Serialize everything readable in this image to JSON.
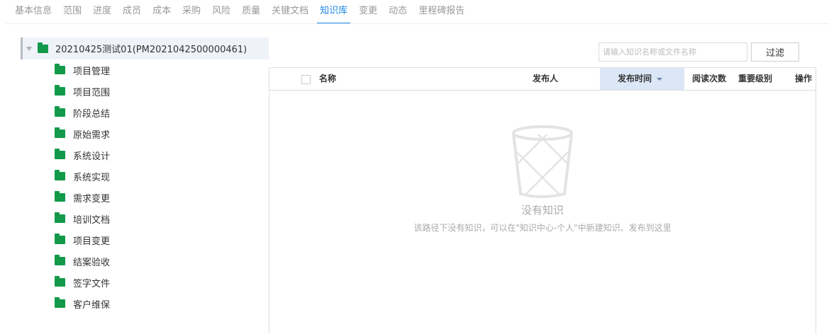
{
  "tabs": [
    {
      "label": "基本信息",
      "active": false
    },
    {
      "label": "范围",
      "active": false
    },
    {
      "label": "进度",
      "active": false
    },
    {
      "label": "成员",
      "active": false
    },
    {
      "label": "成本",
      "active": false
    },
    {
      "label": "采购",
      "active": false
    },
    {
      "label": "风险",
      "active": false
    },
    {
      "label": "质量",
      "active": false
    },
    {
      "label": "关键文档",
      "active": false
    },
    {
      "label": "知识库",
      "active": true
    },
    {
      "label": "变更",
      "active": false
    },
    {
      "label": "动态",
      "active": false
    },
    {
      "label": "里程碑报告",
      "active": false
    }
  ],
  "tree": {
    "root_label": "20210425测试01(PM2021042500000461)",
    "items": [
      "项目管理",
      "项目范围",
      "阶段总结",
      "原始需求",
      "系统设计",
      "系统实现",
      "需求变更",
      "培训文档",
      "项目变更",
      "结案验收",
      "签字文件",
      "客户维保"
    ]
  },
  "filter": {
    "placeholder": "请输入知识名称或文件名称",
    "value": "",
    "button_label": "过滤"
  },
  "table": {
    "columns": {
      "name": "名称",
      "publisher": "发布人",
      "publish_time": "发布时间",
      "read_count": "阅读次数",
      "importance": "重要级别",
      "actions": "操作"
    },
    "sorted_column": "publish_time",
    "sort_direction": "descending"
  },
  "empty_state": {
    "icon": "trash-bin-icon",
    "title": "没有知识",
    "description": "该路径下没有知识，可以在\"知识中心-个人\"中新建知识、发布到这里"
  },
  "colors": {
    "accent": "#1e88e5",
    "folder": "#129a4a",
    "sorted_header_bg": "#dbe6f6",
    "tree_root_bg": "#eff3f9"
  }
}
